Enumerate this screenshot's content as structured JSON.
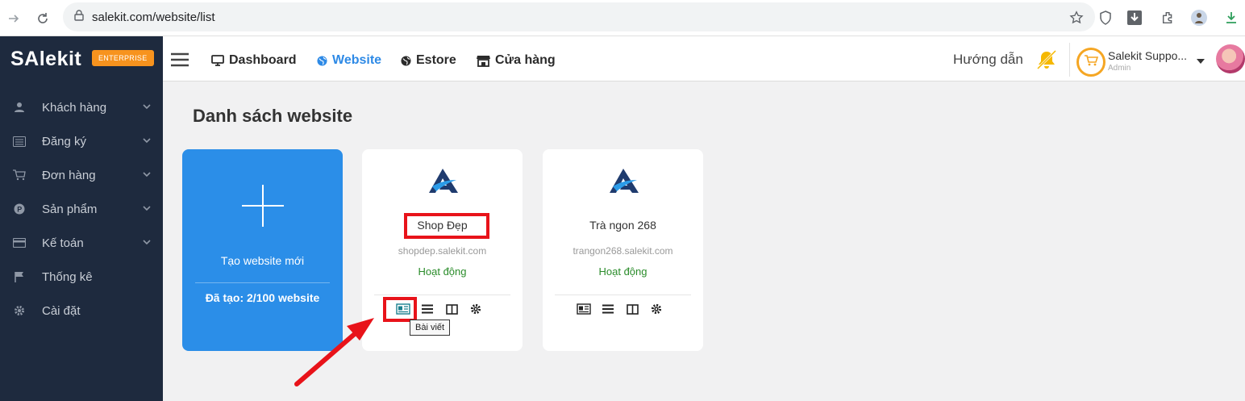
{
  "browser": {
    "url": "salekit.com/website/list"
  },
  "sidebar": {
    "logo": "SAlekit",
    "badge": "ENTERPRISE",
    "items": [
      {
        "label": "Khách hàng",
        "icon": "user-icon"
      },
      {
        "label": "Đăng ký",
        "icon": "list-icon"
      },
      {
        "label": "Đơn hàng",
        "icon": "cart-icon"
      },
      {
        "label": "Sản phẩm",
        "icon": "product-icon"
      },
      {
        "label": "Kế toán",
        "icon": "card-icon"
      },
      {
        "label": "Thống kê",
        "icon": "flag-icon"
      },
      {
        "label": "Cài đặt",
        "icon": "gear-icon"
      }
    ]
  },
  "header": {
    "menu": [
      {
        "label": "Dashboard",
        "icon": "monitor-icon"
      },
      {
        "label": "Website",
        "icon": "globe-icon"
      },
      {
        "label": "Estore",
        "icon": "globe-icon"
      },
      {
        "label": "Cửa hàng",
        "icon": "store-icon"
      }
    ],
    "guide": "Hướng dẫn",
    "user_name": "Salekit Suppo...",
    "user_role": "Admin"
  },
  "main": {
    "title": "Danh sách website",
    "new_card": {
      "label": "Tạo website mới",
      "count": "Đã tạo: 2/100 website"
    },
    "sites": [
      {
        "name": "Shop Đẹp",
        "domain": "shopdep.salekit.com",
        "status": "Hoạt động"
      },
      {
        "name": "Trà ngon 268",
        "domain": "trangon268.salekit.com",
        "status": "Hoạt động"
      }
    ],
    "tooltip": "Bài viết"
  },
  "colors": {
    "accent": "#2b8ee8",
    "sidebar": "#1e2a3e",
    "badge": "#f7931e",
    "status": "#2a8c2a",
    "highlight": "#e8131a"
  }
}
